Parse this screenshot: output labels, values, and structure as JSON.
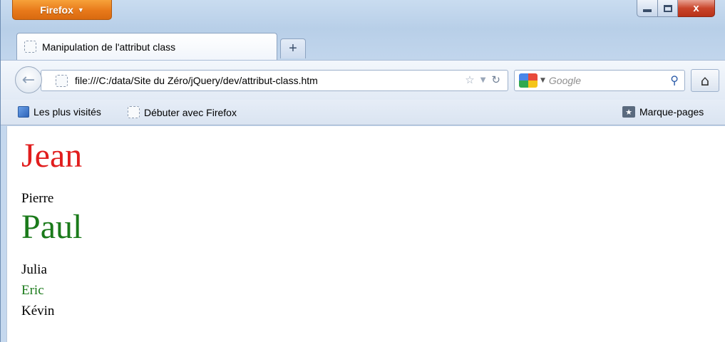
{
  "window": {
    "app_button_label": "Firefox",
    "close_label": "x"
  },
  "tabs": [
    {
      "label": "Manipulation de l'attribut class",
      "active": true
    }
  ],
  "new_tab_label": "+",
  "navigation": {
    "url": "file:///C:/data/Site du Zéro/jQuery/dev/attribut-class.htm",
    "search_placeholder": "Google"
  },
  "bookmarks": {
    "items": [
      {
        "label": "Les plus visités",
        "icon": "most-visited-icon"
      },
      {
        "label": "Débuter avec Firefox",
        "icon": "page-icon"
      }
    ],
    "menu_label": "Marque-pages"
  },
  "content": {
    "names": [
      {
        "text": "Jean",
        "size": "big",
        "color": "#e11d1d"
      },
      {
        "text": "Pierre",
        "size": "small",
        "color": "#000000"
      },
      {
        "text": "Paul",
        "size": "big",
        "color": "#1a7a1a"
      },
      {
        "text": "Julia",
        "size": "small",
        "color": "#000000"
      },
      {
        "text": "Eric",
        "size": "small",
        "color": "#1a7a1a"
      },
      {
        "text": "Kévin",
        "size": "small",
        "color": "#000000"
      }
    ]
  }
}
